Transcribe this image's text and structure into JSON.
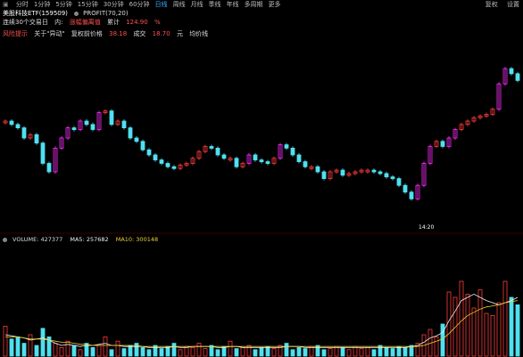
{
  "toolbar": {
    "items": [
      "分时",
      "1分钟",
      "5分钟",
      "15分钟",
      "30分钟",
      "60分钟",
      "日线",
      "周线",
      "月线",
      "季线",
      "年线",
      "多周期",
      "更多"
    ],
    "active_index": 6,
    "right_items": [
      "复权",
      "设置"
    ]
  },
  "info_line1": {
    "name": "美股科技ETF(159509)",
    "indicator": "PROFIT(70,20)"
  },
  "info_line2": {
    "a": "连续30个交易日",
    "b": "内:",
    "c": "涨幅偏离值",
    "d": "累计",
    "e": "124.90",
    "f": "%"
  },
  "info_line3": {
    "a": "风险提示",
    "b": "关于\"异动\"",
    "c": "复权前价格",
    "d": "38.18",
    "e": "成交",
    "f": "18.70",
    "g": "元",
    "h": "均价线"
  },
  "volume_legend": {
    "volume": "VOLUME: 427377",
    "ma5": "MA5: 257682",
    "ma10": "MA10: 300148"
  },
  "time_tag": "14:20",
  "colors": {
    "up": "#ff3c3c",
    "down": "#4fe0f0",
    "magenta": "#ff2cff",
    "ma5": "#f0f0f0",
    "ma10": "#f0d030",
    "ma20": "#ff4cff",
    "active": "#33b5ff"
  },
  "chart_data": [
    {
      "type": "candlestick",
      "series": [
        {
          "name": "",
          "values": [
            0.6,
            0.58,
            0.56,
            0.5,
            0.52,
            0.47,
            0.35,
            0.3,
            0.44,
            0.5,
            0.56,
            0.55,
            0.6,
            0.58,
            0.55,
            0.65,
            0.66,
            0.58,
            0.6,
            0.56,
            0.5,
            0.48,
            0.43,
            0.4,
            0.37,
            0.35,
            0.33,
            0.32,
            0.34,
            0.35,
            0.38,
            0.42,
            0.45,
            0.44,
            0.4,
            0.38,
            0.38,
            0.33,
            0.35,
            0.4,
            0.37,
            0.36,
            0.35,
            0.38,
            0.46,
            0.44,
            0.4,
            0.36,
            0.33,
            0.33,
            0.3,
            0.26,
            0.3,
            0.31,
            0.28,
            0.29,
            0.3,
            0.31,
            0.31,
            0.3,
            0.29,
            0.27,
            0.26,
            0.22,
            0.18,
            0.14,
            0.22,
            0.35,
            0.45,
            0.48,
            0.45,
            0.5,
            0.55,
            0.58,
            0.6,
            0.62,
            0.63,
            0.64,
            0.67,
            0.82,
            0.91,
            0.88,
            0.84
          ]
        }
      ]
    },
    {
      "type": "bar",
      "series": [
        {
          "name": "VOLUME",
          "values": [
            0.28,
            0.16,
            0.18,
            0.12,
            0.2,
            0.1,
            0.26,
            0.18,
            0.12,
            0.08,
            0.14,
            0.1,
            0.06,
            0.12,
            0.08,
            0.1,
            0.18,
            0.06,
            0.14,
            0.07,
            0.1,
            0.12,
            0.08,
            0.06,
            0.1,
            0.07,
            0.09,
            0.12,
            0.06,
            0.09,
            0.08,
            0.12,
            0.07,
            0.1,
            0.06,
            0.09,
            0.14,
            0.07,
            0.08,
            0.1,
            0.06,
            0.08,
            0.09,
            0.07,
            0.1,
            0.12,
            0.06,
            0.08,
            0.07,
            0.09,
            0.1,
            0.06,
            0.07,
            0.09,
            0.08,
            0.06,
            0.09,
            0.07,
            0.08,
            0.06,
            0.1,
            0.08,
            0.07,
            0.09,
            0.08,
            0.1,
            0.12,
            0.2,
            0.25,
            0.18,
            0.3,
            0.6,
            0.55,
            0.7,
            0.58,
            0.45,
            0.62,
            0.4,
            0.38,
            0.5,
            0.7,
            0.55,
            0.48
          ]
        },
        {
          "name": "MA5",
          "values": [
            0.2,
            0.19,
            0.18,
            0.17,
            0.15,
            0.16,
            0.17,
            0.15,
            0.12,
            0.1,
            0.11,
            0.1,
            0.09,
            0.1,
            0.1,
            0.11,
            0.12,
            0.1,
            0.1,
            0.09,
            0.09,
            0.09,
            0.09,
            0.08,
            0.08,
            0.08,
            0.08,
            0.09,
            0.08,
            0.08,
            0.09,
            0.09,
            0.09,
            0.09,
            0.08,
            0.08,
            0.09,
            0.09,
            0.08,
            0.08,
            0.08,
            0.08,
            0.08,
            0.08,
            0.08,
            0.09,
            0.09,
            0.09,
            0.08,
            0.08,
            0.08,
            0.08,
            0.08,
            0.08,
            0.08,
            0.08,
            0.08,
            0.08,
            0.08,
            0.08,
            0.08,
            0.08,
            0.08,
            0.08,
            0.08,
            0.09,
            0.1,
            0.13,
            0.17,
            0.19,
            0.22,
            0.33,
            0.42,
            0.52,
            0.55,
            0.58,
            0.55,
            0.52,
            0.5,
            0.48,
            0.5,
            0.52,
            0.55
          ]
        },
        {
          "name": "MA10",
          "values": [
            0.18,
            0.18,
            0.18,
            0.17,
            0.16,
            0.16,
            0.16,
            0.15,
            0.14,
            0.13,
            0.13,
            0.12,
            0.11,
            0.11,
            0.1,
            0.1,
            0.1,
            0.1,
            0.1,
            0.1,
            0.1,
            0.1,
            0.09,
            0.09,
            0.09,
            0.09,
            0.09,
            0.09,
            0.09,
            0.09,
            0.09,
            0.09,
            0.09,
            0.09,
            0.09,
            0.09,
            0.09,
            0.09,
            0.09,
            0.09,
            0.09,
            0.09,
            0.09,
            0.09,
            0.09,
            0.09,
            0.09,
            0.09,
            0.09,
            0.09,
            0.09,
            0.09,
            0.09,
            0.09,
            0.09,
            0.09,
            0.09,
            0.09,
            0.09,
            0.09,
            0.09,
            0.09,
            0.09,
            0.09,
            0.09,
            0.09,
            0.09,
            0.1,
            0.12,
            0.14,
            0.16,
            0.21,
            0.27,
            0.33,
            0.38,
            0.41,
            0.44,
            0.46,
            0.47,
            0.48,
            0.5,
            0.51,
            0.52
          ]
        }
      ]
    }
  ]
}
